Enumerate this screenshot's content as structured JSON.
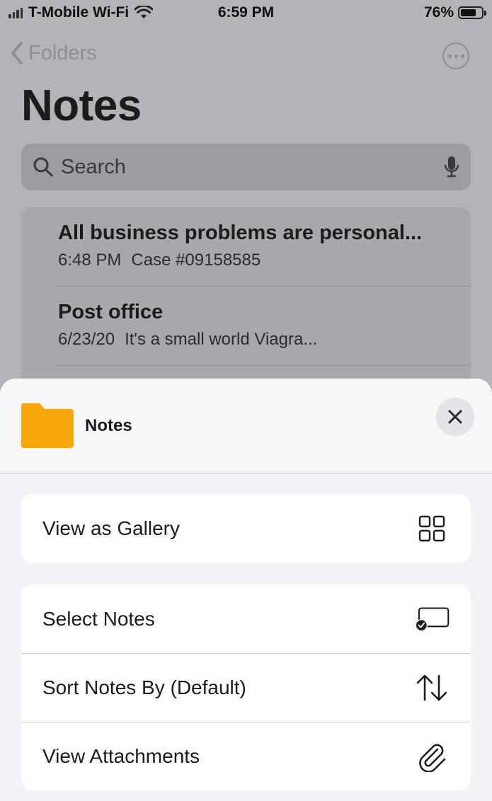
{
  "status_bar": {
    "carrier": "T-Mobile Wi-Fi",
    "time": "6:59 PM",
    "battery": "76%",
    "battery_level": 0.76
  },
  "nav": {
    "back_label": "Folders",
    "title": "Notes"
  },
  "search": {
    "placeholder": "Search"
  },
  "notes": [
    {
      "title": "All business problems are personal...",
      "time": "6:48 PM",
      "preview": "Case #09158585"
    },
    {
      "title": "Post office",
      "time": "6/23/20",
      "preview": "It's a small world Viagra..."
    }
  ],
  "sheet": {
    "folder_name": "Notes",
    "folder_color": "#f9a80b",
    "groups": [
      [
        {
          "label": "View as Gallery",
          "icon": "gallery-grid-icon"
        }
      ],
      [
        {
          "label": "Select Notes",
          "icon": "select-checkmark-icon"
        },
        {
          "label": "Sort Notes By (Default)",
          "icon": "sort-arrows-icon"
        },
        {
          "label": "View Attachments",
          "icon": "paperclip-icon"
        }
      ]
    ]
  }
}
